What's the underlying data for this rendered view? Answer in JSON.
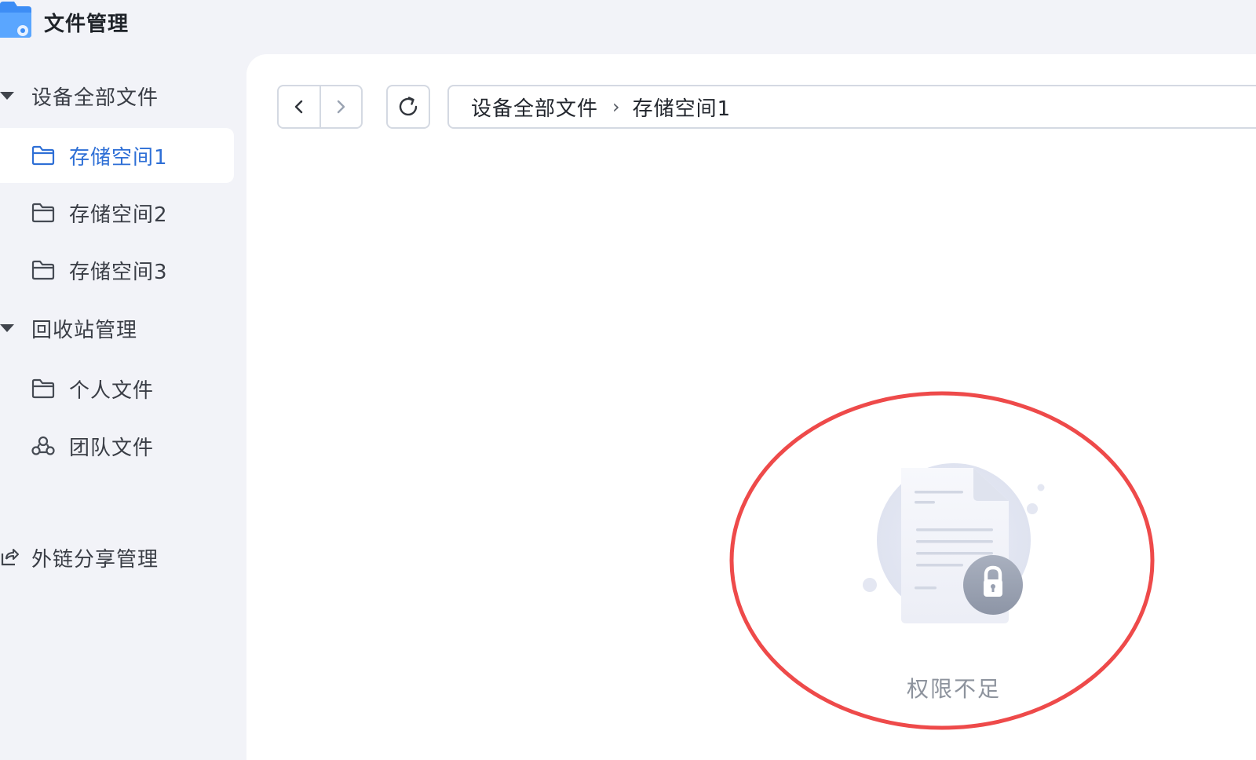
{
  "app": {
    "title": "文件管理",
    "logo_icon": "folder-gear-icon"
  },
  "sidebar": {
    "groups": [
      {
        "label": "设备全部文件",
        "expanded": true,
        "items": [
          {
            "label": "存储空间1",
            "icon": "folder-icon",
            "active": true
          },
          {
            "label": "存储空间2",
            "icon": "folder-icon",
            "active": false
          },
          {
            "label": "存储空间3",
            "icon": "folder-icon",
            "active": false
          }
        ]
      },
      {
        "label": "回收站管理",
        "expanded": true,
        "items": [
          {
            "label": "个人文件",
            "icon": "folder-icon",
            "active": false
          },
          {
            "label": "团队文件",
            "icon": "team-icon",
            "active": false
          }
        ]
      }
    ],
    "share": {
      "label": "外链分享管理",
      "icon": "share-link-icon"
    }
  },
  "toolbar": {
    "back_icon": "chevron-left-icon",
    "forward_icon": "chevron-right-icon",
    "refresh_icon": "refresh-icon"
  },
  "breadcrumb": {
    "items": [
      "设备全部文件",
      "存储空间1"
    ],
    "separator": "›"
  },
  "empty_state": {
    "message": "权限不足",
    "icon": "locked-document-icon"
  },
  "colors": {
    "accent": "#2e6fd6",
    "sidebar_bg": "#f2f3f8",
    "annotation": "#ee4a4a"
  }
}
